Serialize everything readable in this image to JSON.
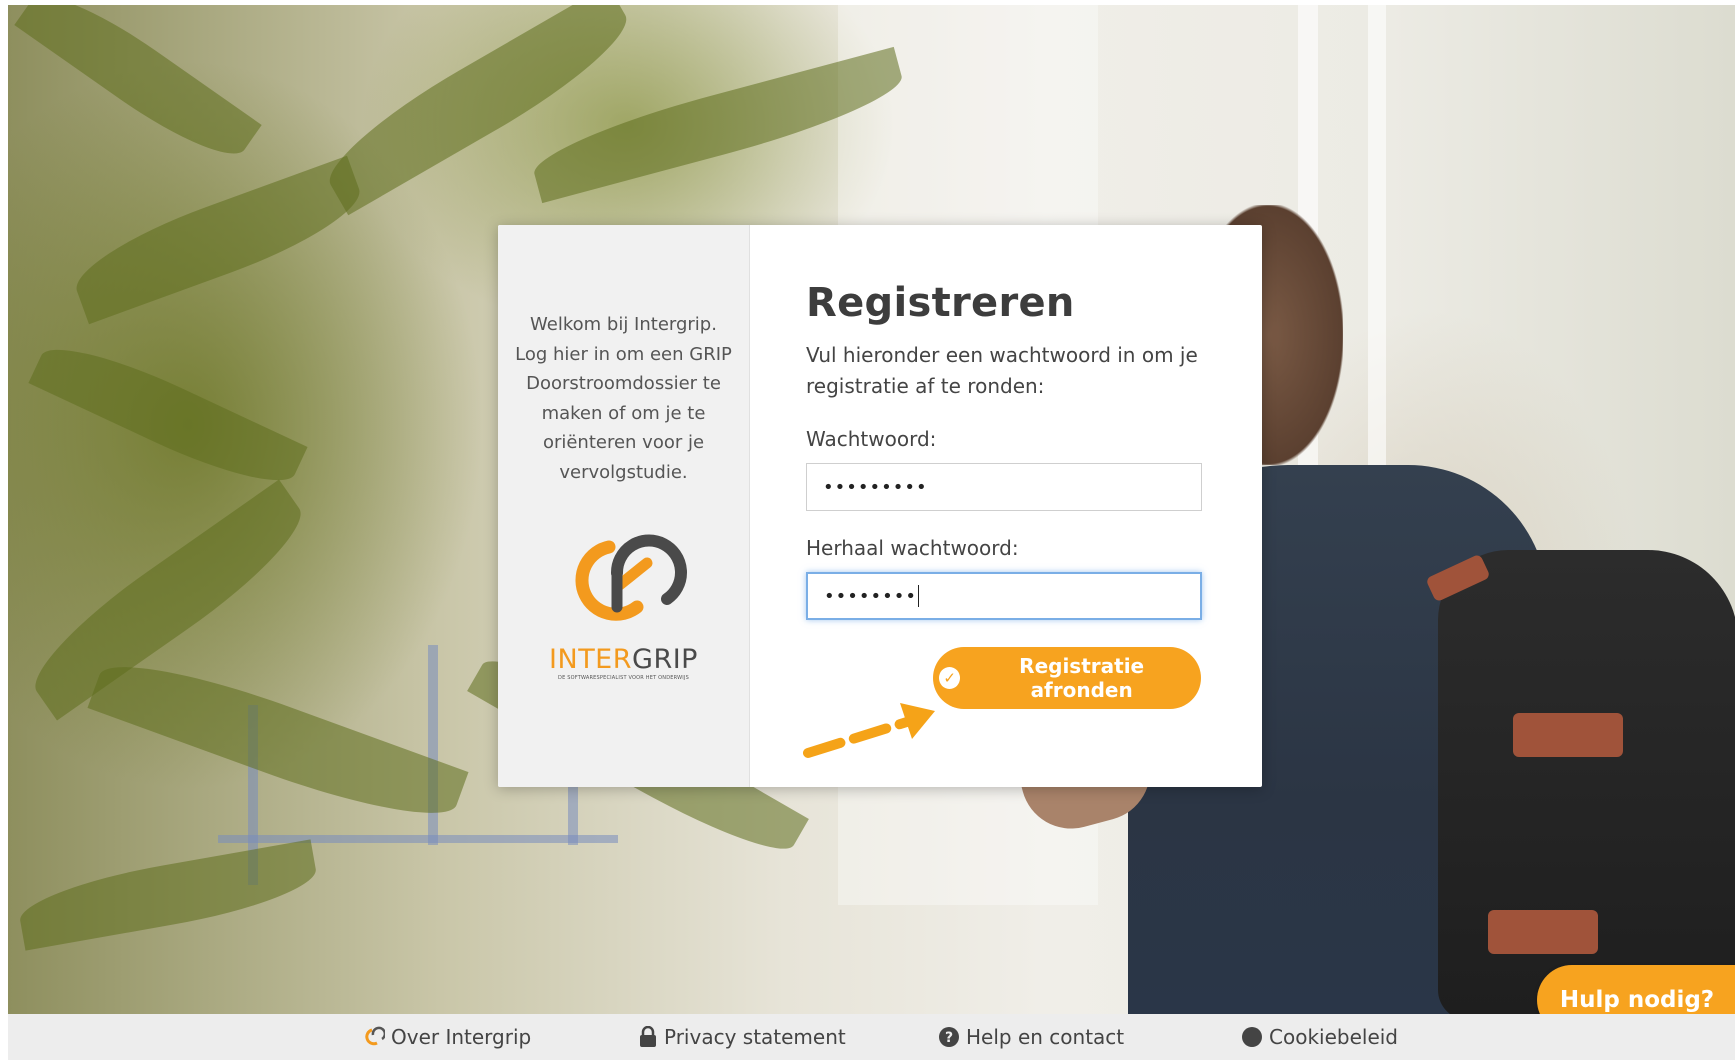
{
  "card": {
    "welcome_text": "Welkom bij Intergrip. Log hier in om een GRIP Doorstroomdossier te maken of om je te oriënteren voor je vervolgstudie.",
    "logo": {
      "word_part1": "INTER",
      "word_part2": "GRIP",
      "tagline": "DE SOFTWARESPECIALIST VOOR HET ONDERWIJS"
    },
    "title": "Registreren",
    "intro": "Vul hieronder een wachtwoord in om je registratie af te ronden:",
    "password_label": "Wachtwoord:",
    "password_value": "•••••••••",
    "repeat_label": "Herhaal wachtwoord:",
    "repeat_value": "••••••••",
    "submit_label": "Registratie afronden"
  },
  "footer": {
    "items": [
      {
        "label": "Over Intergrip",
        "icon": "intergrip-logo-icon"
      },
      {
        "label": "Privacy statement",
        "icon": "lock-icon"
      },
      {
        "label": "Help en contact",
        "icon": "question-circle-icon"
      },
      {
        "label": "Cookiebeleid",
        "icon": "circle-icon"
      }
    ]
  },
  "help_button": "Hulp nodig?",
  "colors": {
    "accent": "#f7a31f",
    "logo_orange": "#f39a1e",
    "logo_dark": "#4a4a4a",
    "focus_border": "#7aaee6"
  }
}
